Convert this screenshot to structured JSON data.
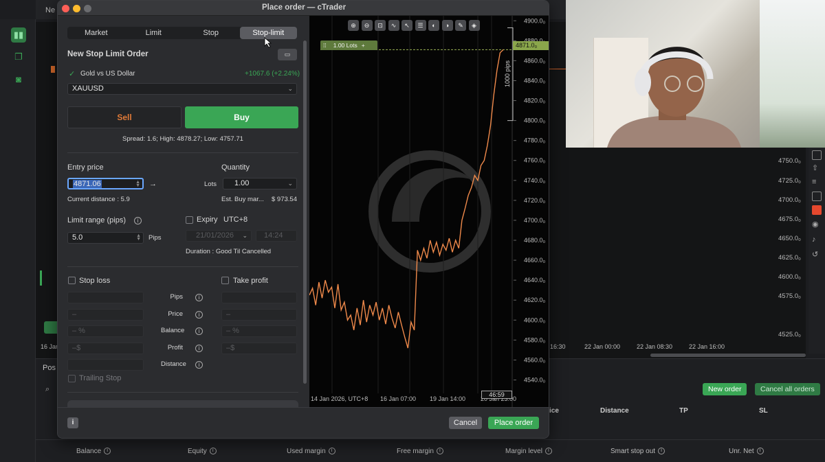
{
  "window_title": "Place order — cTrader",
  "bg": {
    "tab_label": "Ne",
    "right_axis": [
      "4750.0₀",
      "4725.0₀",
      "4700.0₀",
      "4675.0₀",
      "4650.0₀",
      "4625.0₀",
      "4600.0₀",
      "4575.0₀",
      "4525.0₀"
    ],
    "time_labels": [
      "16:30",
      "22 Jan 00:00",
      "22 Jan 08:30",
      "22 Jan 16:00"
    ],
    "left_date": "16 Jan",
    "pos_label": "Pos",
    "new_order": "New order",
    "cancel_all": "Cancel all orders",
    "columns": [
      "ice",
      "Distance",
      "TP",
      "SL"
    ],
    "stats": [
      "Balance",
      "Equity",
      "Used margin",
      "Free margin",
      "Margin level",
      "Smart stop out",
      "Unr. Net"
    ]
  },
  "tabs": [
    "Market",
    "Limit",
    "Stop",
    "Stop-limit"
  ],
  "active_tab": "Stop-limit",
  "order_title": "New Stop Limit Order",
  "symbol": {
    "name": "Gold vs US Dollar",
    "change": "+1067.6 (+2.24%)",
    "code": "XAUUSD"
  },
  "sell_label": "Sell",
  "buy_label": "Buy",
  "spread_line": "Spread: 1.6; High: 4878.27; Low: 4757.71",
  "entry": {
    "label": "Entry price",
    "value": "4871.06",
    "arrow": "→",
    "distance": "Current distance : 5.9"
  },
  "quantity": {
    "label": "Quantity",
    "unit": "Lots",
    "value": "1.00",
    "est_label": "Est. Buy mar...",
    "est_value": "$ 973.54"
  },
  "limit_range": {
    "label": "Limit range (pips)",
    "value": "5.0",
    "unit": "Pips"
  },
  "expiry": {
    "label": "Expiry",
    "tz": "UTC+8",
    "date": "21/01/2026",
    "time": "14:24",
    "duration": "Duration : Good Til Cancelled"
  },
  "stop_loss": {
    "label": "Stop loss"
  },
  "take_profit": {
    "label": "Take profit"
  },
  "mid_labels": [
    "Pips",
    "Price",
    "Balance",
    "Profit",
    "Distance"
  ],
  "sl_placeholders": [
    "",
    "–",
    "– %",
    "–$",
    ""
  ],
  "tp_placeholders": [
    "",
    "–",
    "– %",
    "–$"
  ],
  "trailing_stop": "Trailing Stop",
  "cancel_label": "Cancel",
  "place_label": "Place order",
  "info_label": "i",
  "chart": {
    "order_line_lots": "1.00 Lots",
    "order_price": "4871.0₀",
    "pips_label": "1000 pips",
    "countdown": "46:59",
    "x_labels": [
      "14 Jan 2026, UTC+8",
      "16 Jan 07:00",
      "19 Jan 14:00",
      "20 Jan 23:00"
    ],
    "y_labels": [
      "4900.0₀",
      "4880.0₀",
      "4860.0₀",
      "4840.0₀",
      "4820.0₀",
      "4800.0₀",
      "4780.0₀",
      "4760.0₀",
      "4740.0₀",
      "4720.0₀",
      "4700.0₀",
      "4680.0₀",
      "4660.0₀",
      "4640.0₀",
      "4620.0₀",
      "4600.0₀",
      "4580.0₀",
      "4560.0₀",
      "4540.0₀"
    ],
    "tool_icons": [
      "zoom-in-icon",
      "zoom-out-icon",
      "zoom-fit-icon",
      "indicator-icon",
      "cursor-icon",
      "list-icon",
      "logo-icon",
      "hide-icon",
      "pencil-icon",
      "layers-icon"
    ],
    "y_min": 4530,
    "y_max": 4905,
    "line_color": "#f08a4b",
    "price_series": [
      4625,
      4632,
      4615,
      4638,
      4622,
      4640,
      4628,
      4633,
      4612,
      4636,
      4610,
      4618,
      4600,
      4605,
      4590,
      4612,
      4595,
      4620,
      4598,
      4615,
      4605,
      4618,
      4600,
      4612,
      4596,
      4615,
      4602,
      4592,
      4608,
      4595,
      4583,
      4572,
      4598,
      4590,
      4670,
      4660,
      4672,
      4662,
      4680,
      4668,
      4678,
      4665,
      4676,
      4670,
      4682,
      4668,
      4680,
      4672,
      4700,
      4712,
      4725,
      4733,
      4745,
      4740,
      4755,
      4760,
      4775,
      4795,
      4825,
      4850,
      4868,
      4871
    ]
  }
}
